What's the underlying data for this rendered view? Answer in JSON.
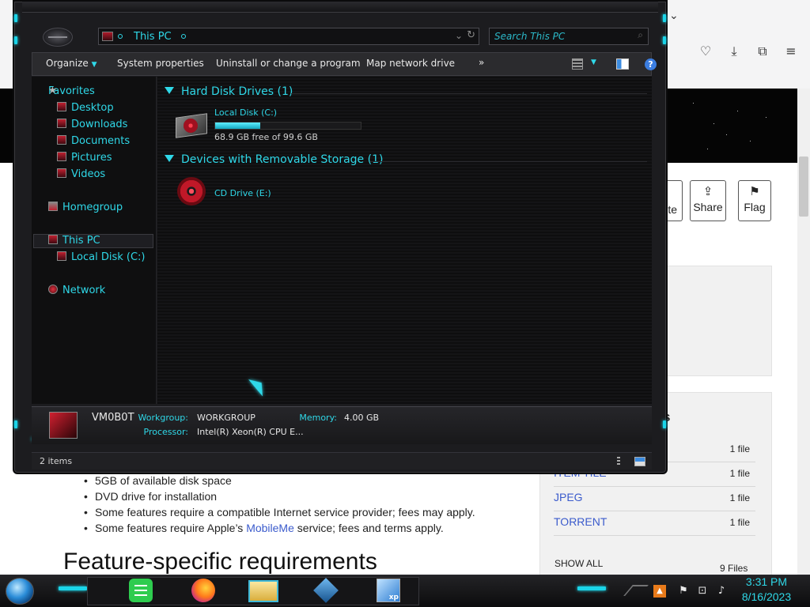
{
  "browser": {
    "toolbar_icons": [
      "pocket-icon",
      "download-icon",
      "extensions-icon",
      "menu-icon"
    ],
    "actions": [
      {
        "label": "rite",
        "icon": "pencil-icon"
      },
      {
        "label": "Share",
        "icon": "share-icon"
      },
      {
        "label": "Flag",
        "icon": "flag-icon"
      }
    ],
    "files_panel": {
      "heading_fragment": "s",
      "rows": [
        {
          "name": "",
          "count": "1 file"
        },
        {
          "name": "ITEM TILE",
          "count": "1 file"
        },
        {
          "name": "JPEG",
          "count": "1 file"
        },
        {
          "name": "TORRENT",
          "count": "1 file"
        }
      ],
      "show_all": "SHOW ALL",
      "total": "9 Files"
    },
    "requirements": [
      "5GB of available disk space",
      "DVD drive for installation",
      "Some features require a compatible Internet service provider; fees may apply.",
      {
        "before": "Some features require Apple’s ",
        "link": "MobileMe",
        "after": " service; fees and terms apply."
      }
    ],
    "section_heading": "Feature-specific requirements"
  },
  "explorer": {
    "address": "This PC",
    "search_placeholder": "Search This PC",
    "commands": [
      "Organize",
      "System properties",
      "Uninstall or change a program",
      "Map network drive"
    ],
    "more": "»",
    "nav": {
      "favorites": "Favorites",
      "desktop": "Desktop",
      "downloads": "Downloads",
      "documents": "Documents",
      "pictures": "Pictures",
      "videos": "Videos",
      "homegroup": "Homegroup",
      "this_pc": "This PC",
      "local_disk": "Local Disk (C:)",
      "network": "Network"
    },
    "groups": {
      "hard_disks": "Hard Disk Drives (1)",
      "removable": "Devices with Removable Storage (1)"
    },
    "drive_c": {
      "name": "Local Disk (C:)",
      "free_text": "68.9 GB free of 99.6 GB",
      "used_fraction": 0.308
    },
    "drive_e": {
      "name": "CD Drive (E:)"
    },
    "details": {
      "computer_name": "VM0B0T",
      "workgroup_label": "Workgroup:",
      "workgroup": "WORKGROUP",
      "memory_label": "Memory:",
      "memory": "4.00 GB",
      "processor_label": "Processor:",
      "processor": "Intel(R) Xeon(R) CPU E..."
    },
    "status": "2 items",
    "accent": "#2fd8e8"
  },
  "taskbar": {
    "apps": [
      "notes-icon",
      "firefox-icon",
      "file-explorer-icon",
      "virtualbox-icon",
      "xp-mode-icon"
    ],
    "xp_badge": "xp",
    "time": "3:31 PM",
    "date": "8/16/2023"
  }
}
